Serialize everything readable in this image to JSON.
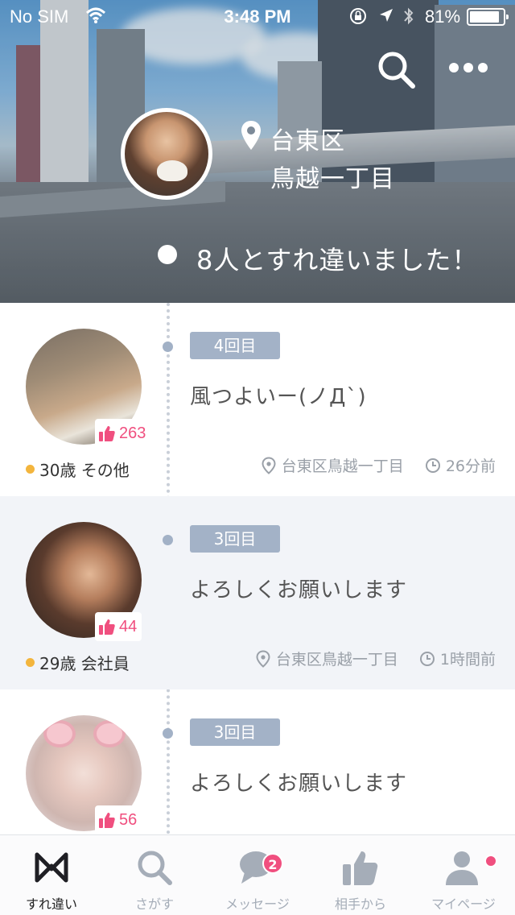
{
  "status_bar": {
    "carrier": "No SIM",
    "time": "3:48 PM",
    "battery_percent": "81%",
    "icons": [
      "wifi-icon",
      "orientation-lock-icon",
      "location-arrow-icon",
      "bluetooth-icon",
      "battery-icon"
    ]
  },
  "header": {
    "location_line1": "台東区",
    "location_line2": "鳥越一丁目",
    "encounter_count_text": "8人とすれ違いました！",
    "icons": [
      "search-icon",
      "more-icon",
      "location-pin-icon"
    ]
  },
  "encounters": [
    {
      "likes": "263",
      "age_job": "30歳 その他",
      "times": "4回目",
      "message": "風つよいー(ノД`)",
      "place": "台東区鳥越一丁目",
      "ago": "26分前"
    },
    {
      "likes": "44",
      "age_job": "29歳 会社員",
      "times": "3回目",
      "message": "よろしくお願いします",
      "place": "台東区鳥越一丁目",
      "ago": "1時間前"
    },
    {
      "likes": "56",
      "times": "3回目",
      "message": "よろしくお願いします"
    }
  ],
  "tabs": [
    {
      "label": "すれ違い",
      "icon": "passing-logo-icon",
      "active": true
    },
    {
      "label": "さがす",
      "icon": "search-icon"
    },
    {
      "label": "メッセージ",
      "icon": "chat-bubble-icon",
      "badge": "2"
    },
    {
      "label": "相手から",
      "icon": "thumbs-up-icon"
    },
    {
      "label": "マイページ",
      "icon": "person-icon"
    }
  ],
  "colors": {
    "accent_pink": "#f04f7f",
    "tag_blue_gray": "#a3b2c7",
    "status_dot_yellow": "#f3b53d",
    "alt_row_bg": "#f2f4f8"
  }
}
